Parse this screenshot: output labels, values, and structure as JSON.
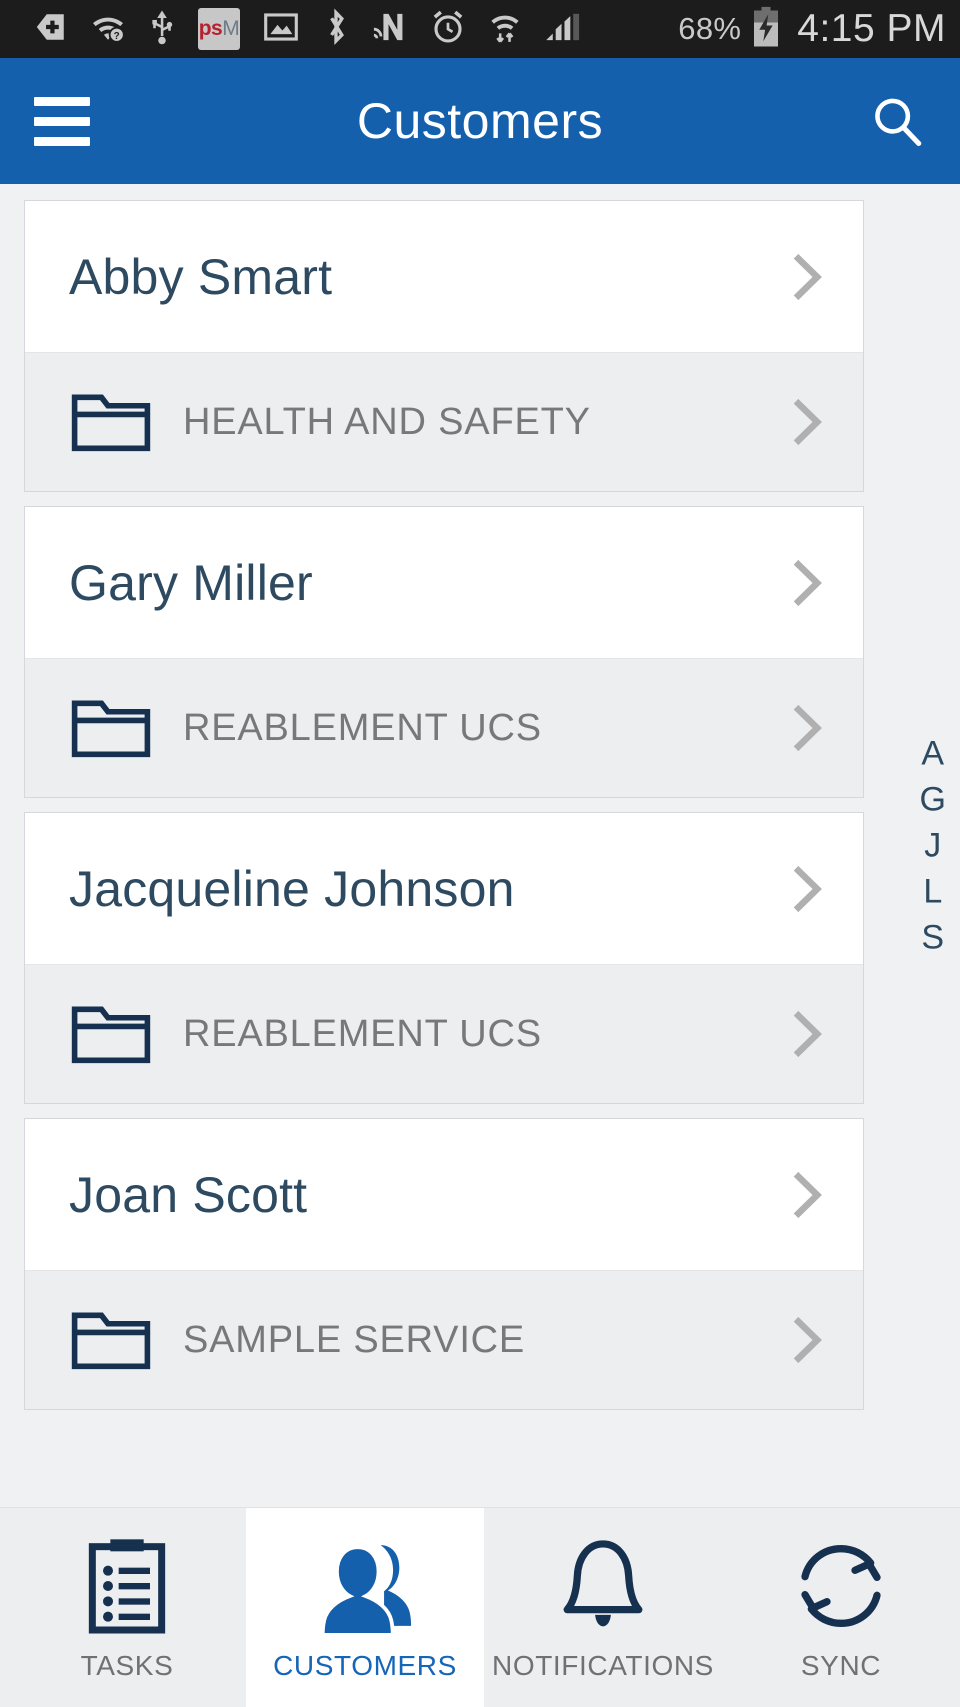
{
  "status_bar": {
    "icons": [
      "add-tag-icon",
      "wifi-question-icon",
      "usb-icon",
      "psm-app-icon",
      "image-icon",
      "bluetooth-icon",
      "nfc-n-icon",
      "alarm-clock-icon",
      "wifi-transfer-icon",
      "signal-bars-icon"
    ],
    "psm_label_p": "ps",
    "psm_label_m": "M",
    "battery_percent": "68%",
    "battery_state": "charging",
    "time": "4:15 PM"
  },
  "app_bar": {
    "menu_icon": "hamburger-menu-icon",
    "title": "Customers",
    "search_icon": "search-icon",
    "background_color": "#1560ad"
  },
  "customers": [
    {
      "name": "Abby Smart",
      "service": "HEALTH AND SAFETY"
    },
    {
      "name": "Gary Miller",
      "service": "REABLEMENT UCS"
    },
    {
      "name": "Jacqueline Johnson",
      "service": "REABLEMENT UCS"
    },
    {
      "name": "Joan Scott",
      "service": "SAMPLE SERVICE"
    }
  ],
  "alpha_index": [
    "A",
    "G",
    "J",
    "L",
    "S"
  ],
  "bottom_nav": {
    "active": "CUSTOMERS",
    "items": [
      {
        "label": "TASKS",
        "icon": "clipboard-list-icon",
        "active": false
      },
      {
        "label": "CUSTOMERS",
        "icon": "people-icon",
        "active": true
      },
      {
        "label": "NOTIFICATIONS",
        "icon": "bell-icon",
        "active": false
      },
      {
        "label": "SYNC",
        "icon": "sync-arrows-icon",
        "active": false
      }
    ]
  },
  "colors": {
    "accent_blue": "#1560ad",
    "name_text": "#2e4a61",
    "service_text": "#76787a",
    "icon_navy": "#16304f",
    "chevron_grey": "#b0b0b0",
    "page_bg": "#eff1f3"
  }
}
